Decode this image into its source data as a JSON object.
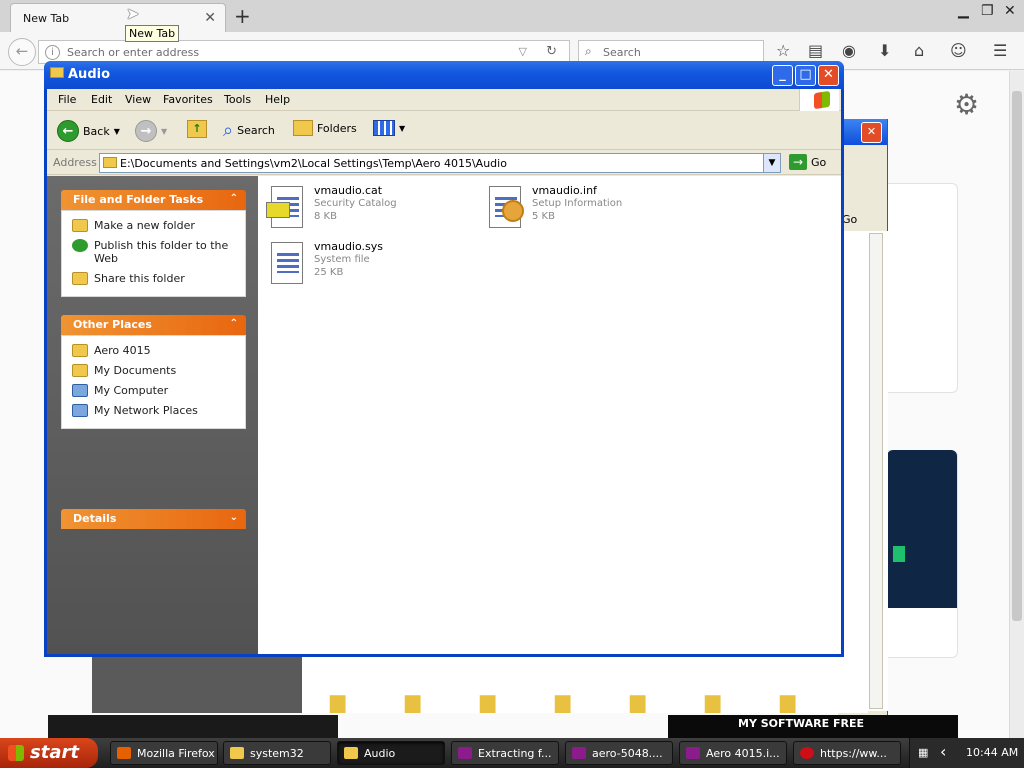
{
  "firefox": {
    "tab_label": "New Tab",
    "tooltip": "New Tab",
    "url_placeholder": "Search or enter address",
    "search_placeholder": "Search"
  },
  "window": {
    "title": "Audio",
    "menu": [
      "File",
      "Edit",
      "View",
      "Favorites",
      "Tools",
      "Help"
    ],
    "toolbar": {
      "back": "Back",
      "search": "Search",
      "folders": "Folders"
    },
    "address_label": "Address",
    "address_value": "E:\\Documents and Settings\\vm2\\Local Settings\\Temp\\Aero 4015\\Audio",
    "go_label": "Go"
  },
  "sidebar": {
    "file_tasks": {
      "title": "File and Folder Tasks",
      "items": [
        "Make a new folder",
        "Publish this folder to the Web",
        "Share this folder"
      ]
    },
    "other_places": {
      "title": "Other Places",
      "items": [
        "Aero 4015",
        "My Documents",
        "My Computer",
        "My Network Places"
      ]
    },
    "details": {
      "title": "Details"
    }
  },
  "files": [
    {
      "name": "vmaudio.cat",
      "type": "Security Catalog",
      "size": "8 KB"
    },
    {
      "name": "vmaudio.inf",
      "type": "Setup Information",
      "size": "5 KB"
    },
    {
      "name": "vmaudio.sys",
      "type": "System file",
      "size": "25 KB"
    }
  ],
  "background_window": {
    "go_label": "Go"
  },
  "background_page": {
    "banner": "MY SOFTWARE FREE"
  },
  "taskbar": {
    "start": "start",
    "items": [
      "Mozilla Firefox",
      "system32",
      "Audio",
      "Extracting f...",
      "aero-5048....",
      "Aero 4015.i...",
      "https://ww..."
    ],
    "clock": "10:44 AM"
  },
  "colors": {
    "xp_blue": "#0d4bd1",
    "task_orange": "#e8660f",
    "taskbar": "#1f1f1f"
  }
}
